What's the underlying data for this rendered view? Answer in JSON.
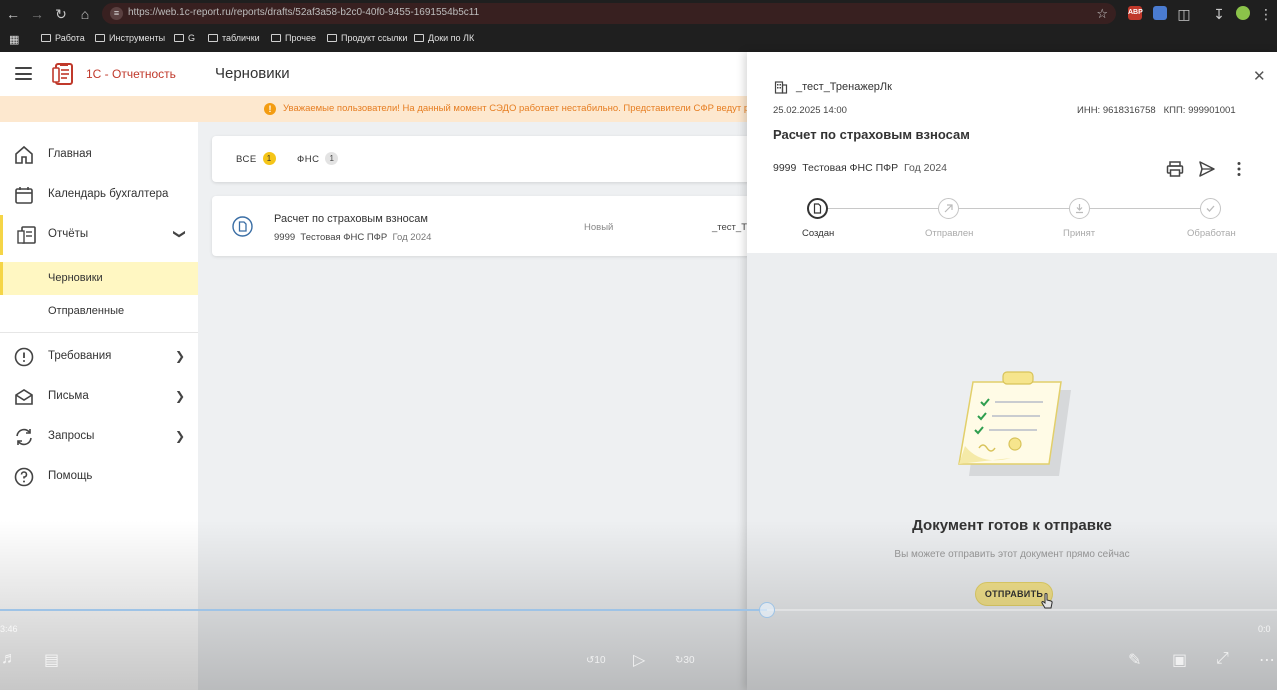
{
  "browser": {
    "url": "https://web.1c-report.ru/reports/drafts/52af3a58-b2c0-40f0-9455-1691554b5c11",
    "bookmarks": [
      "Работа",
      "Инструменты",
      "G",
      "таблички",
      "Прочее",
      "Продукт ссылки",
      "Доки по ЛК"
    ],
    "ext_abp": "ABP"
  },
  "header": {
    "brand": "1С - Отчетность",
    "page_title": "Черновики"
  },
  "notice": {
    "text": "Уважаемые пользователи! На данный момент СЭДО работает нестабильно. Представители СФР ведут р"
  },
  "sidebar": {
    "items": [
      {
        "label": "Главная"
      },
      {
        "label": "Календарь бухгалтера"
      },
      {
        "label": "Отчёты"
      },
      {
        "label": "Требования"
      },
      {
        "label": "Письма"
      },
      {
        "label": "Запросы"
      },
      {
        "label": "Помощь"
      }
    ],
    "sub_items": [
      {
        "label": "Черновики"
      },
      {
        "label": "Отправленные"
      }
    ]
  },
  "filters": {
    "tabs": [
      {
        "label": "ВСЕ",
        "count": "1"
      },
      {
        "label": "ФНС",
        "count": "1"
      }
    ]
  },
  "draft_row": {
    "title": "Расчет по страховым взносам",
    "code": "9999",
    "authority": "Тестовая ФНС ПФР",
    "period": "Год 2024",
    "status": "Новый",
    "org": "_тест_Тр"
  },
  "drawer": {
    "org": "_тест_ТренажерЛк",
    "date": "25.02.2025 14:00",
    "inn": "ИНН: 9618316758",
    "kpp": "КПП: 999901001",
    "title": "Расчет по страховым взносам",
    "code": "9999",
    "authority": "Тестовая ФНС ПФР",
    "period": "Год 2024",
    "steps": [
      {
        "label": "Создан"
      },
      {
        "label": "Отправлен"
      },
      {
        "label": "Принят"
      },
      {
        "label": "Обработан"
      }
    ],
    "empty_title": "Документ готов к отправке",
    "empty_subtitle": "Вы можете отправить этот документ прямо сейчас",
    "send_label": "ОТПРАВИТЬ"
  },
  "video": {
    "time_left": "3:46",
    "time_right": "0:0",
    "rewind": "10",
    "forward": "30"
  },
  "colors": {
    "brand_red": "#c0392b",
    "accent_yellow": "#f5d547",
    "notice_bg": "#fde8cf",
    "notice_text": "#e67e22",
    "send_button": "#f6e58d"
  }
}
